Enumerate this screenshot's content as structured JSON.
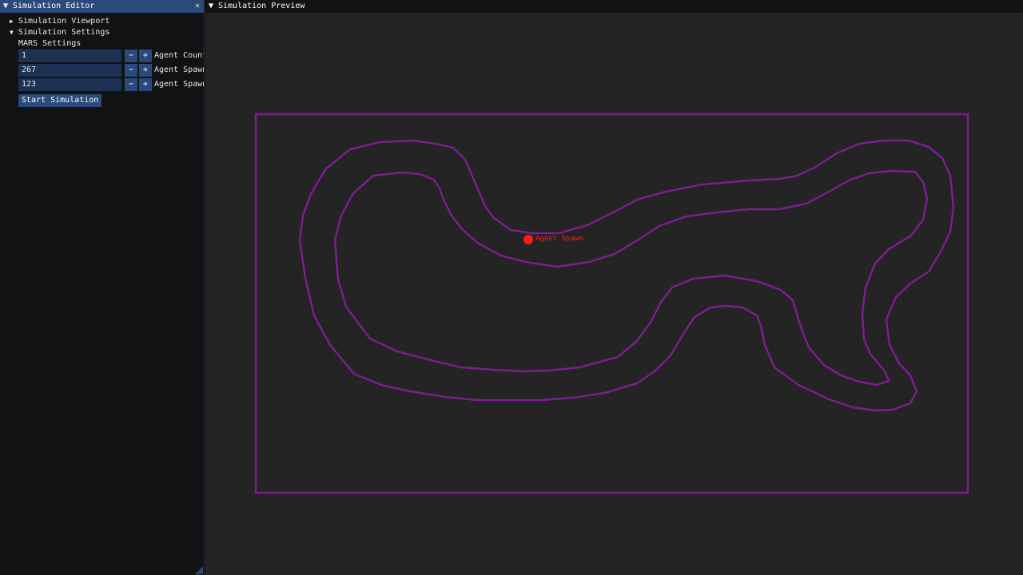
{
  "editor": {
    "title": "Simulation Editor",
    "collapse_glyph": "▼",
    "close_glyph": "✕",
    "tree": [
      {
        "label": "Simulation Viewport",
        "arrow": "▶"
      },
      {
        "label": "Simulation Settings",
        "arrow": "▼"
      }
    ],
    "section_label": "MARS Settings",
    "fields": [
      {
        "value": "1",
        "label": "Agent Count"
      },
      {
        "value": "267",
        "label": "Agent Spawn"
      },
      {
        "value": "123",
        "label": "Agent Spawn"
      }
    ],
    "minus_glyph": "−",
    "plus_glyph": "+",
    "start_button": "Start Simulation"
  },
  "preview": {
    "title": "Simulation Preview",
    "collapse_glyph": "▼",
    "spawn_label": "Agent Spawn",
    "colors": {
      "track": "#7a1f8c",
      "spawn": "#ff1a1a",
      "background": "#242424"
    }
  }
}
